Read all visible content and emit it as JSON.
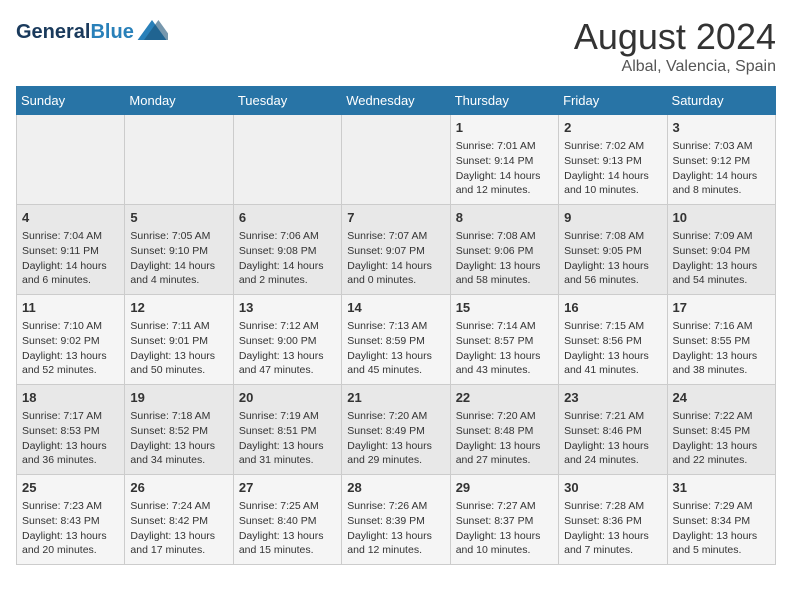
{
  "header": {
    "logo_line1": "General",
    "logo_line2": "Blue",
    "month_year": "August 2024",
    "location": "Albal, Valencia, Spain"
  },
  "days_of_week": [
    "Sunday",
    "Monday",
    "Tuesday",
    "Wednesday",
    "Thursday",
    "Friday",
    "Saturday"
  ],
  "weeks": [
    [
      {
        "day": "",
        "info": ""
      },
      {
        "day": "",
        "info": ""
      },
      {
        "day": "",
        "info": ""
      },
      {
        "day": "",
        "info": ""
      },
      {
        "day": "1",
        "info": "Sunrise: 7:01 AM\nSunset: 9:14 PM\nDaylight: 14 hours\nand 12 minutes."
      },
      {
        "day": "2",
        "info": "Sunrise: 7:02 AM\nSunset: 9:13 PM\nDaylight: 14 hours\nand 10 minutes."
      },
      {
        "day": "3",
        "info": "Sunrise: 7:03 AM\nSunset: 9:12 PM\nDaylight: 14 hours\nand 8 minutes."
      }
    ],
    [
      {
        "day": "4",
        "info": "Sunrise: 7:04 AM\nSunset: 9:11 PM\nDaylight: 14 hours\nand 6 minutes."
      },
      {
        "day": "5",
        "info": "Sunrise: 7:05 AM\nSunset: 9:10 PM\nDaylight: 14 hours\nand 4 minutes."
      },
      {
        "day": "6",
        "info": "Sunrise: 7:06 AM\nSunset: 9:08 PM\nDaylight: 14 hours\nand 2 minutes."
      },
      {
        "day": "7",
        "info": "Sunrise: 7:07 AM\nSunset: 9:07 PM\nDaylight: 14 hours\nand 0 minutes."
      },
      {
        "day": "8",
        "info": "Sunrise: 7:08 AM\nSunset: 9:06 PM\nDaylight: 13 hours\nand 58 minutes."
      },
      {
        "day": "9",
        "info": "Sunrise: 7:08 AM\nSunset: 9:05 PM\nDaylight: 13 hours\nand 56 minutes."
      },
      {
        "day": "10",
        "info": "Sunrise: 7:09 AM\nSunset: 9:04 PM\nDaylight: 13 hours\nand 54 minutes."
      }
    ],
    [
      {
        "day": "11",
        "info": "Sunrise: 7:10 AM\nSunset: 9:02 PM\nDaylight: 13 hours\nand 52 minutes."
      },
      {
        "day": "12",
        "info": "Sunrise: 7:11 AM\nSunset: 9:01 PM\nDaylight: 13 hours\nand 50 minutes."
      },
      {
        "day": "13",
        "info": "Sunrise: 7:12 AM\nSunset: 9:00 PM\nDaylight: 13 hours\nand 47 minutes."
      },
      {
        "day": "14",
        "info": "Sunrise: 7:13 AM\nSunset: 8:59 PM\nDaylight: 13 hours\nand 45 minutes."
      },
      {
        "day": "15",
        "info": "Sunrise: 7:14 AM\nSunset: 8:57 PM\nDaylight: 13 hours\nand 43 minutes."
      },
      {
        "day": "16",
        "info": "Sunrise: 7:15 AM\nSunset: 8:56 PM\nDaylight: 13 hours\nand 41 minutes."
      },
      {
        "day": "17",
        "info": "Sunrise: 7:16 AM\nSunset: 8:55 PM\nDaylight: 13 hours\nand 38 minutes."
      }
    ],
    [
      {
        "day": "18",
        "info": "Sunrise: 7:17 AM\nSunset: 8:53 PM\nDaylight: 13 hours\nand 36 minutes."
      },
      {
        "day": "19",
        "info": "Sunrise: 7:18 AM\nSunset: 8:52 PM\nDaylight: 13 hours\nand 34 minutes."
      },
      {
        "day": "20",
        "info": "Sunrise: 7:19 AM\nSunset: 8:51 PM\nDaylight: 13 hours\nand 31 minutes."
      },
      {
        "day": "21",
        "info": "Sunrise: 7:20 AM\nSunset: 8:49 PM\nDaylight: 13 hours\nand 29 minutes."
      },
      {
        "day": "22",
        "info": "Sunrise: 7:20 AM\nSunset: 8:48 PM\nDaylight: 13 hours\nand 27 minutes."
      },
      {
        "day": "23",
        "info": "Sunrise: 7:21 AM\nSunset: 8:46 PM\nDaylight: 13 hours\nand 24 minutes."
      },
      {
        "day": "24",
        "info": "Sunrise: 7:22 AM\nSunset: 8:45 PM\nDaylight: 13 hours\nand 22 minutes."
      }
    ],
    [
      {
        "day": "25",
        "info": "Sunrise: 7:23 AM\nSunset: 8:43 PM\nDaylight: 13 hours\nand 20 minutes."
      },
      {
        "day": "26",
        "info": "Sunrise: 7:24 AM\nSunset: 8:42 PM\nDaylight: 13 hours\nand 17 minutes."
      },
      {
        "day": "27",
        "info": "Sunrise: 7:25 AM\nSunset: 8:40 PM\nDaylight: 13 hours\nand 15 minutes."
      },
      {
        "day": "28",
        "info": "Sunrise: 7:26 AM\nSunset: 8:39 PM\nDaylight: 13 hours\nand 12 minutes."
      },
      {
        "day": "29",
        "info": "Sunrise: 7:27 AM\nSunset: 8:37 PM\nDaylight: 13 hours\nand 10 minutes."
      },
      {
        "day": "30",
        "info": "Sunrise: 7:28 AM\nSunset: 8:36 PM\nDaylight: 13 hours\nand 7 minutes."
      },
      {
        "day": "31",
        "info": "Sunrise: 7:29 AM\nSunset: 8:34 PM\nDaylight: 13 hours\nand 5 minutes."
      }
    ]
  ]
}
